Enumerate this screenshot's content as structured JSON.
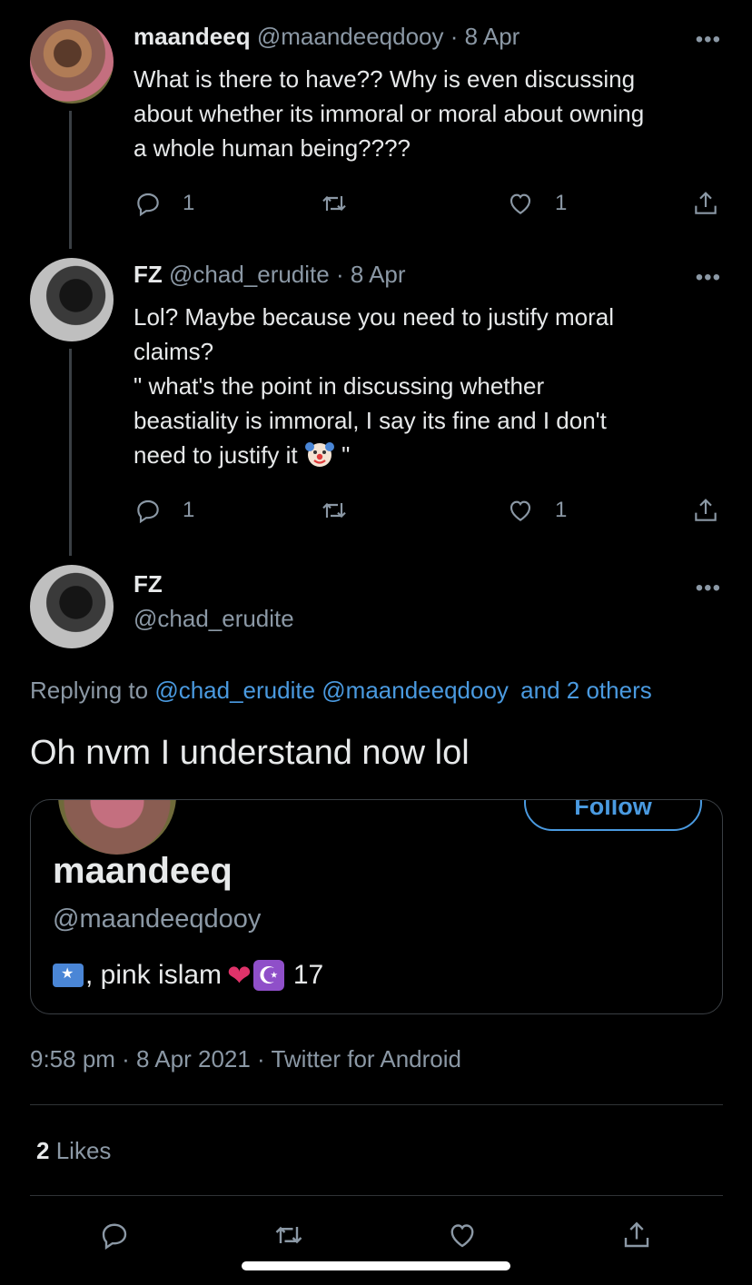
{
  "tweets": [
    {
      "name": "maandeeq",
      "meta": "@maandeeqdooy · 8 Apr",
      "lines": [
        "What is there to have?? Why is even discussing",
        "about whether its immoral or moral about owning",
        "a whole human being????"
      ],
      "reply_count": "1",
      "like_count": "1"
    },
    {
      "name": "FZ",
      "meta": "@chad_erudite · 8 Apr",
      "lines": [
        "Lol? Maybe because you need to justify moral",
        "claims?",
        "\" what's the point in discussing whether",
        "beastiality is immoral, I say its fine and I don't",
        "need to justify it"
      ],
      "trailing": " \"",
      "reply_count": "1",
      "like_count": "1"
    }
  ],
  "main": {
    "name": "FZ",
    "handle": "@chad_erudite",
    "replying_prefix": "Replying to",
    "replying_links": [
      "@chad_erudite",
      "@maandeeqdooy",
      "and 2 others"
    ],
    "text": "Oh nvm I understand now lol",
    "card": {
      "follow_label": "Follow",
      "name": "maandeeq",
      "handle": "@maandeeqdooy",
      "bio_text": ", pink islam",
      "bio_number": "17"
    },
    "timestamp": "9:58 pm · 8 Apr 2021 · Twitter for Android",
    "likes_count": "2",
    "likes_label": "Likes"
  },
  "more_label": "•••",
  "colors": {
    "background": "#000000",
    "link": "#4a9ae0",
    "secondary_text": "#8b98a5"
  },
  "icons": [
    "reply-icon",
    "retweet-icon",
    "like-icon",
    "share-icon",
    "more-icon"
  ]
}
